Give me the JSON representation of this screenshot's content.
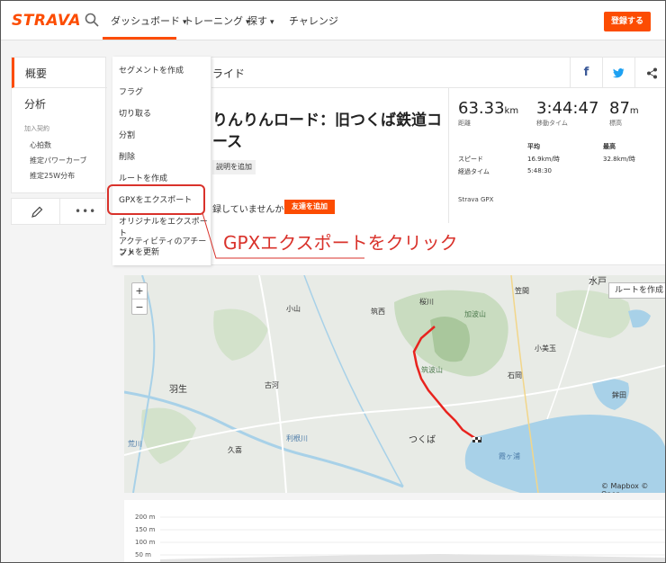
{
  "nav": {
    "logo": "STRAVA",
    "items": [
      {
        "label": "ダッシュボード",
        "chevron": "▾"
      },
      {
        "label": "トレーニング",
        "chevron": "▾"
      },
      {
        "label": "探す",
        "chevron": "▾"
      },
      {
        "label": "チャレンジ",
        "chevron": ""
      }
    ],
    "signup": "登録する",
    "accent": "#fc4c02"
  },
  "sidebar": {
    "overview": "概要",
    "analysis": "分析",
    "sub_head": "加入契約",
    "sub_items": [
      "心拍数",
      "推定パワーカーブ",
      "推定25W分布"
    ],
    "more": "•••"
  },
  "card": {
    "header_title": "ライド",
    "social": {
      "facebook": "f",
      "twitter": "t",
      "share": "share-icon"
    },
    "activity_title": "りんりんロード：旧つくば鉄道コース",
    "add_description": "説明を追加",
    "ride_question": "録していませんか？",
    "add_friend": "友達を追加",
    "stats": [
      {
        "value": "63.33",
        "unit": "km",
        "label": "距離"
      },
      {
        "value": "3:44:47",
        "unit": "",
        "label": "移動タイム"
      },
      {
        "value": "87",
        "unit": "m",
        "label": "標高"
      }
    ],
    "table": {
      "headers": [
        "平均",
        "最高"
      ],
      "rows": [
        {
          "label": "スピード",
          "avg": "16.9km/時",
          "max": "32.8km/時"
        },
        {
          "label": "経過タイム",
          "avg": "5:48:30",
          "max": ""
        }
      ]
    },
    "device": "Strava GPX"
  },
  "dropdown": {
    "items": [
      "セグメントを作成",
      "フラグ",
      "切り取る",
      "分割",
      "削除",
      "ルートを作成",
      "GPXをエクスポート",
      "オリジナルをエクスポート",
      "アクティビティのアチーブメ",
      "ントを更新"
    ]
  },
  "annotation": {
    "text": "GPXエクスポートをクリック",
    "color": "#d9322b"
  },
  "map": {
    "zoom_in": "+",
    "zoom_out": "−",
    "route_button": "ルートを作成",
    "labels": [
      {
        "text": "水戸"
      },
      {
        "text": "笠間"
      },
      {
        "text": "桜川"
      },
      {
        "text": "筑西"
      },
      {
        "text": "小山"
      },
      {
        "text": "加波山"
      },
      {
        "text": "小美玉"
      },
      {
        "text": "石岡"
      },
      {
        "text": "筑波山"
      },
      {
        "text": "古河"
      },
      {
        "text": "羽生"
      },
      {
        "text": "鉾田"
      },
      {
        "text": "つくば"
      },
      {
        "text": "利根川"
      },
      {
        "text": "霞ヶ浦"
      },
      {
        "text": "荒川"
      },
      {
        "text": "久喜"
      }
    ],
    "attribution": "© Mapbox © Open"
  },
  "elevation": {
    "ticks": [
      "200 m",
      "150 m",
      "100 m",
      "50 m"
    ]
  }
}
